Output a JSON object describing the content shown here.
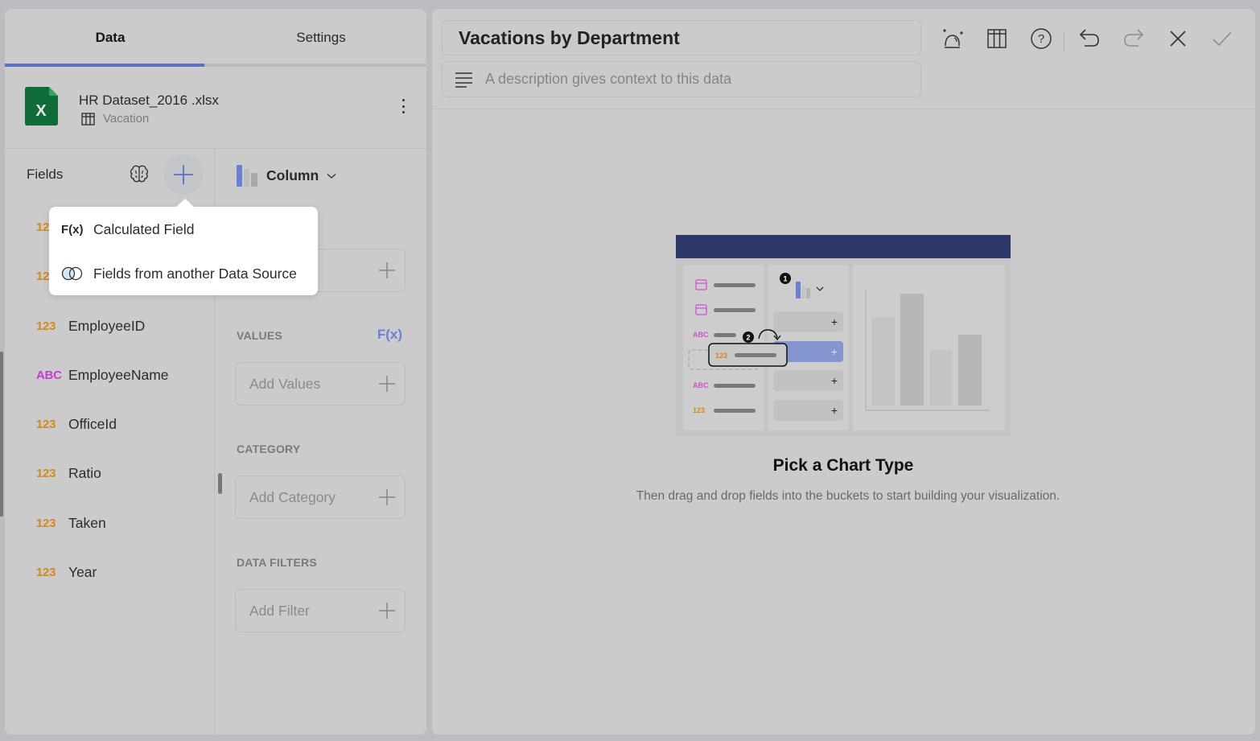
{
  "left_panel": {
    "tabs": [
      {
        "label": "Data",
        "active": true
      },
      {
        "label": "Settings",
        "active": false
      }
    ],
    "datasource": {
      "icon": "excel-file-icon",
      "name": "HR Dataset_2016 .xlsx",
      "sheet_icon": "table-icon",
      "sheet": "Vacation",
      "menu_icon": "kebab-menu-icon"
    },
    "fields": {
      "title": "Fields",
      "brain_icon": "brain-icon",
      "add_icon": "plus-icon",
      "items": [
        {
          "type": "123",
          "kind": "num",
          "label": ""
        },
        {
          "type": "123",
          "kind": "num",
          "label": ""
        },
        {
          "type": "123",
          "kind": "num",
          "label": "EmployeeID"
        },
        {
          "type": "ABC",
          "kind": "text",
          "label": "EmployeeName"
        },
        {
          "type": "123",
          "kind": "num",
          "label": "OfficeId"
        },
        {
          "type": "123",
          "kind": "num",
          "label": "Ratio"
        },
        {
          "type": "123",
          "kind": "num",
          "label": "Taken"
        },
        {
          "type": "123",
          "kind": "num",
          "label": "Year"
        }
      ],
      "partial_type_labels": [
        "12",
        "12"
      ]
    },
    "add_menu": {
      "items": [
        {
          "icon": "F(x)",
          "label": "Calculated Field"
        },
        {
          "icon": "linked-circles-icon",
          "label": "Fields from another Data Source"
        }
      ]
    },
    "buckets": {
      "chart_type": "Column",
      "values_label": "VALUES",
      "values_fx": "F(x)",
      "values_placeholder": "Add Values",
      "category_label": "CATEGORY",
      "category_placeholder": "Add Category",
      "filters_label": "DATA FILTERS",
      "filters_placeholder": "Add Filter"
    }
  },
  "right_panel": {
    "title": "Vacations by Department",
    "description_placeholder": "A description gives context to this data",
    "toolbar": [
      {
        "name": "magic-insights-icon"
      },
      {
        "name": "table-view-icon"
      },
      {
        "name": "help-icon"
      },
      {
        "name": "undo-icon"
      },
      {
        "name": "redo-icon"
      },
      {
        "name": "close-icon"
      },
      {
        "name": "confirm-check-icon"
      }
    ],
    "empty_state": {
      "title": "Pick a Chart Type",
      "subtitle": "Then drag and drop fields into the buckets to start building your visualization.",
      "illustration": {
        "step_1": "1",
        "step_2": "2",
        "type_123": "123",
        "type_abc": "ABC"
      }
    }
  },
  "colors": {
    "accent": "#5c70c8",
    "number_type": "#d4891d",
    "text_type": "#c63ed0",
    "illustration_header": "#2e3769",
    "panel_bg": "#cbcbcb",
    "page_bg": "#bbbcc0"
  }
}
